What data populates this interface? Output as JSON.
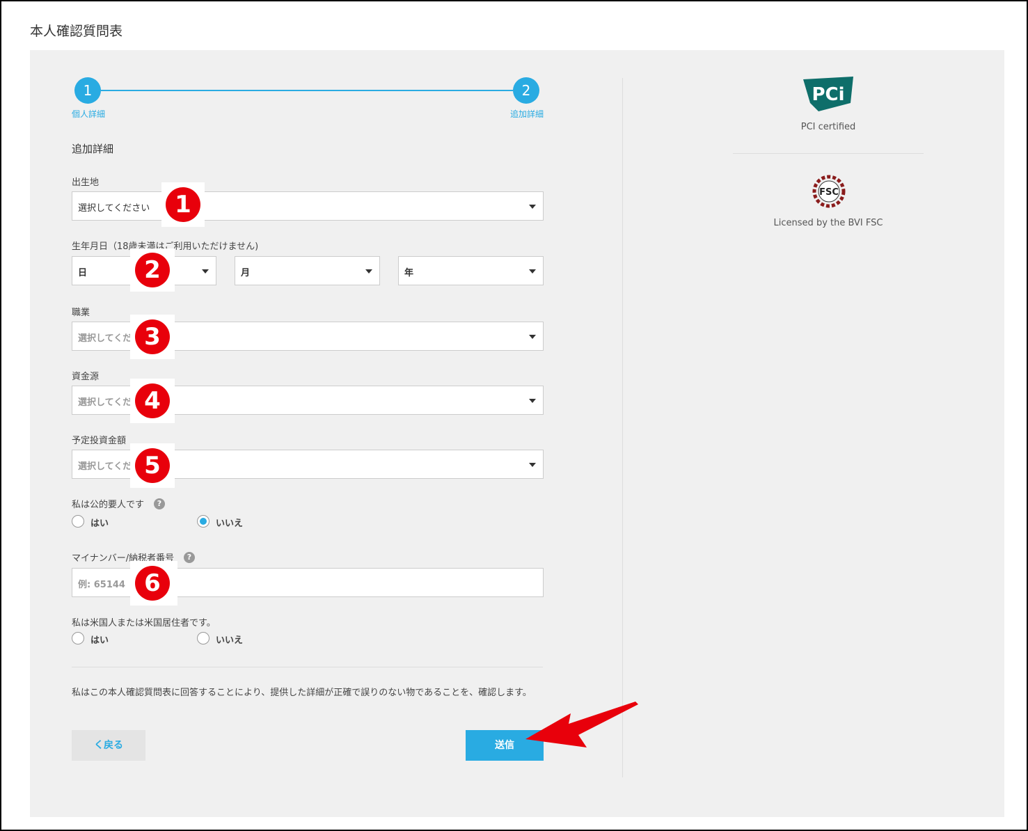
{
  "page": {
    "title": "本人確認質問表"
  },
  "stepper": {
    "steps": [
      {
        "number": "1",
        "label": "個人詳細"
      },
      {
        "number": "2",
        "label": "追加詳細"
      }
    ]
  },
  "form": {
    "section_title": "追加詳細",
    "birthplace": {
      "label": "出生地",
      "value": "選択してください"
    },
    "birthdate": {
      "label": "生年月日（18歳未満はご利用いただけません)",
      "day": "日",
      "month": "月",
      "year": "年"
    },
    "occupation": {
      "label": "職業",
      "placeholder": "選択してくだ"
    },
    "source_of_funds": {
      "label": "資金源",
      "placeholder": "選択してくだ"
    },
    "planned_investment": {
      "label": "予定投資金額",
      "placeholder": "選択してくだ"
    },
    "pep": {
      "label": "私は公的要人です",
      "yes": "はい",
      "no": "いいえ",
      "selected": "no"
    },
    "tax_number": {
      "label": "マイナンバー/納税者番号",
      "placeholder": "例: 65144"
    },
    "us_person": {
      "label": "私は米国人または米国居住者です。",
      "yes": "はい",
      "no": "いいえ"
    },
    "confirmation": "私はこの本人確認質問表に回答することにより、提供した詳細が正確で誤りのない物であることを、確認します。",
    "back_label": "く戻る",
    "submit_label": "送信"
  },
  "sidebar": {
    "pci": {
      "logo_text": "PCi",
      "caption": "PCI certified"
    },
    "fsc": {
      "logo_text": "FSC",
      "caption": "Licensed by the BVI FSC"
    }
  },
  "annotations": [
    "1",
    "2",
    "3",
    "4",
    "5",
    "6"
  ],
  "colors": {
    "accent": "#29abe2",
    "annotation": "#e8000b",
    "panel": "#f0f0f0"
  }
}
